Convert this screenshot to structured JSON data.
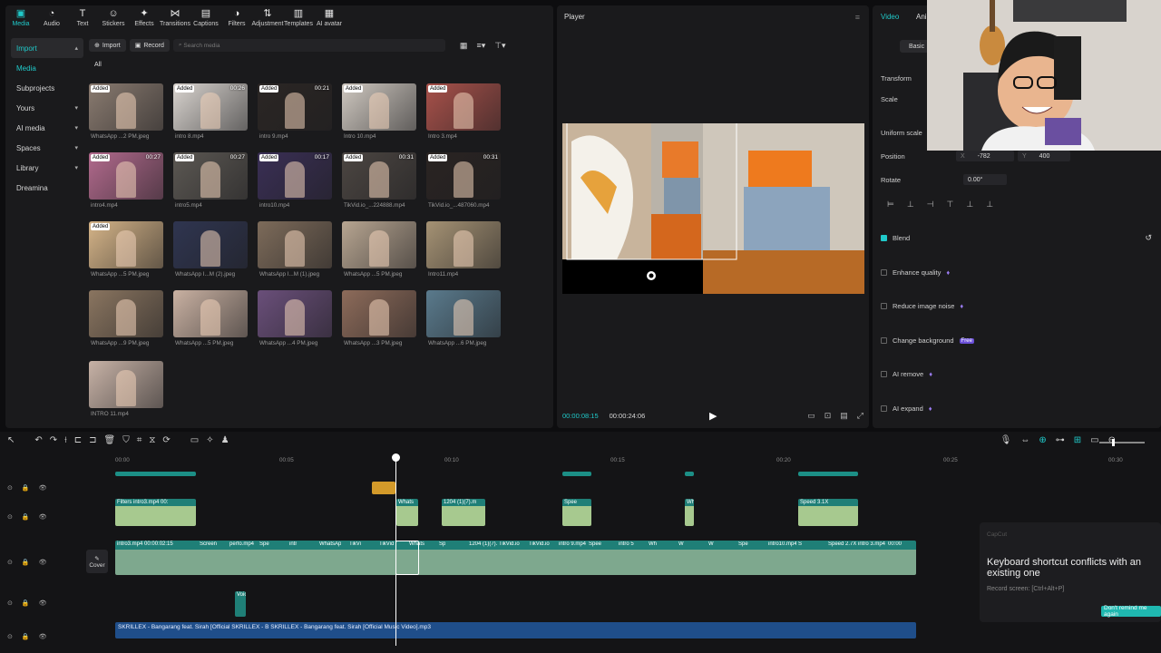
{
  "toolbar": [
    {
      "label": "Media",
      "icon": "media-icon"
    },
    {
      "label": "Audio",
      "icon": "audio-icon"
    },
    {
      "label": "Text",
      "icon": "text-icon"
    },
    {
      "label": "Stickers",
      "icon": "stickers-icon"
    },
    {
      "label": "Effects",
      "icon": "effects-icon"
    },
    {
      "label": "Transitions",
      "icon": "transitions-icon"
    },
    {
      "label": "Captions",
      "icon": "captions-icon"
    },
    {
      "label": "Filters",
      "icon": "filters-icon"
    },
    {
      "label": "Adjustment",
      "icon": "adjustment-icon"
    },
    {
      "label": "Templates",
      "icon": "templates-icon"
    },
    {
      "label": "AI avatar",
      "icon": "avatar-icon"
    }
  ],
  "sidebar": [
    {
      "label": "Import",
      "chev": "▴",
      "sel": true
    },
    {
      "label": "Media",
      "chev": "",
      "sel": true
    },
    {
      "label": "Subprojects",
      "chev": ""
    },
    {
      "label": "Yours",
      "chev": "▾"
    },
    {
      "label": "AI media",
      "chev": "▾"
    },
    {
      "label": "Spaces",
      "chev": "▾"
    },
    {
      "label": "Library",
      "chev": "▾"
    },
    {
      "label": "Dreamina",
      "chev": ""
    }
  ],
  "media_bar": {
    "import": "Import",
    "record": "Record",
    "search_placeholder": "Search media",
    "all_tab": "All"
  },
  "media_items": [
    {
      "label": "WhatsApp ...2 PM.jpeg",
      "badge": "Added",
      "dur": "",
      "color": "#8a7b70"
    },
    {
      "label": "intro 8.mp4",
      "badge": "Added",
      "dur": "00:26",
      "color": "#d9d4cf"
    },
    {
      "label": "intro 9.mp4",
      "badge": "Added",
      "dur": "00:21",
      "color": "#2b2624"
    },
    {
      "label": "Intro 10.mp4",
      "badge": "Added",
      "dur": "",
      "color": "#cfc8c0"
    },
    {
      "label": "Intro 3.mp4",
      "badge": "Added",
      "dur": "",
      "color": "#a8514a"
    },
    {
      "label": "intro4.mp4",
      "badge": "Added",
      "dur": "00:27",
      "color": "#b26a8d"
    },
    {
      "label": "intro5.mp4",
      "badge": "Added",
      "dur": "00:27",
      "color": "#5c5853"
    },
    {
      "label": "intro10.mp4",
      "badge": "Added",
      "dur": "00:17",
      "color": "#3a2f55"
    },
    {
      "label": "TikVid.io_...224888.mp4",
      "badge": "Added",
      "dur": "00:31",
      "color": "#4c4642"
    },
    {
      "label": "TikVid.io_...487060.mp4",
      "badge": "Added",
      "dur": "00:31",
      "color": "#2a2422"
    },
    {
      "label": "WhatsApp ...5 PM.jpeg",
      "badge": "Added",
      "dur": "",
      "color": "#d5b488"
    },
    {
      "label": "WhatsApp I...M (2).jpeg",
      "badge": "",
      "dur": "",
      "color": "#2f3550"
    },
    {
      "label": "WhatsApp I...M (1).jpeg",
      "badge": "",
      "dur": "",
      "color": "#7d6b5a"
    },
    {
      "label": "WhatsApp ...5 PM.jpeg",
      "badge": "",
      "dur": "",
      "color": "#b7a591"
    },
    {
      "label": "Intro11.mp4",
      "badge": "",
      "dur": "",
      "color": "#a59274"
    },
    {
      "label": "WhatsApp ...9 PM.jpeg",
      "badge": "",
      "dur": "",
      "color": "#8a7560"
    },
    {
      "label": "WhatsApp ...5 PM.jpeg",
      "badge": "",
      "dur": "",
      "color": "#c9b1a2"
    },
    {
      "label": "WhatsApp ...4 PM.jpeg",
      "badge": "",
      "dur": "",
      "color": "#6a4f7a"
    },
    {
      "label": "WhatsApp ...3 PM.jpeg",
      "badge": "",
      "dur": "",
      "color": "#8d6b5a"
    },
    {
      "label": "WhatsApp ...6 PM.jpeg",
      "badge": "",
      "dur": "",
      "color": "#5a7a8c"
    },
    {
      "label": "INTRO 11.mp4",
      "badge": "",
      "dur": "",
      "color": "#c7b2a6"
    }
  ],
  "player": {
    "title": "Player",
    "current": "00:00:08:15",
    "total": "00:00:24:06"
  },
  "props": {
    "tab_video": "Video",
    "tab_anim": "Ani",
    "basic": "Basic",
    "transform": "Transform",
    "scale": "Scale",
    "uniform_scale": "Uniform scale",
    "position": "Position",
    "x_label": "X",
    "x_val": "-782",
    "y_label": "Y",
    "y_val": "400",
    "rotate": "Rotate",
    "rotate_val": "0.00°",
    "blend": "Blend",
    "enhance": "Enhance quality",
    "noise": "Reduce image noise",
    "background": "Change background",
    "free": "Free",
    "ai_remove": "AI remove",
    "ai_expand": "AI expand"
  },
  "timeline": {
    "ruler": [
      "00:00",
      "00:05",
      "00:10",
      "00:15",
      "00:20",
      "00:25",
      "00:30"
    ],
    "cover": "Cover",
    "overlay_clips": [
      {
        "label": "Filters intro3.mp4 00:"
      },
      {
        "label": "Whats"
      },
      {
        "label": "1204 (1)(7).m"
      },
      {
        "label": "Spee"
      },
      {
        "label": "Wh"
      },
      {
        "label": "Speed 3.1X"
      }
    ],
    "main_clip_label": "intro3.mp4  00:00:02:15",
    "main_labels": [
      "Screen",
      "perfo.mp4",
      "Spe",
      "intr",
      "WhatsAp",
      "TikVi",
      "TikVid",
      "Whats",
      "Sp",
      "1204 (1)(7).mp4",
      "TikVid.io",
      "TikVid.io",
      "intro 9.mp4",
      "Spee",
      "intro 5",
      "Wh",
      "W",
      "W",
      "Spe",
      "intro10.mp4",
      "S",
      "Speed 2.7X",
      "intro 3.mp4",
      "00:00"
    ],
    "voice_label": "Voic",
    "audio_label": "SKRILLEX - Bangarang feat. Sirah [Official   SKRILLEX - B    SKRILLEX - Bangarang feat. Sirah [Official Music Video].mp3"
  },
  "toast": {
    "brand": "CapCut",
    "title": "Keyboard shortcut conflicts with an existing one",
    "subtitle": "Record screen: [Ctrl+Alt+P]",
    "button": "Don't remind me again"
  },
  "colors": {
    "accent": "#20c9c9",
    "panel": "#1a1a1c",
    "clip": "#1f7f77",
    "audio": "#1f4e8a"
  }
}
